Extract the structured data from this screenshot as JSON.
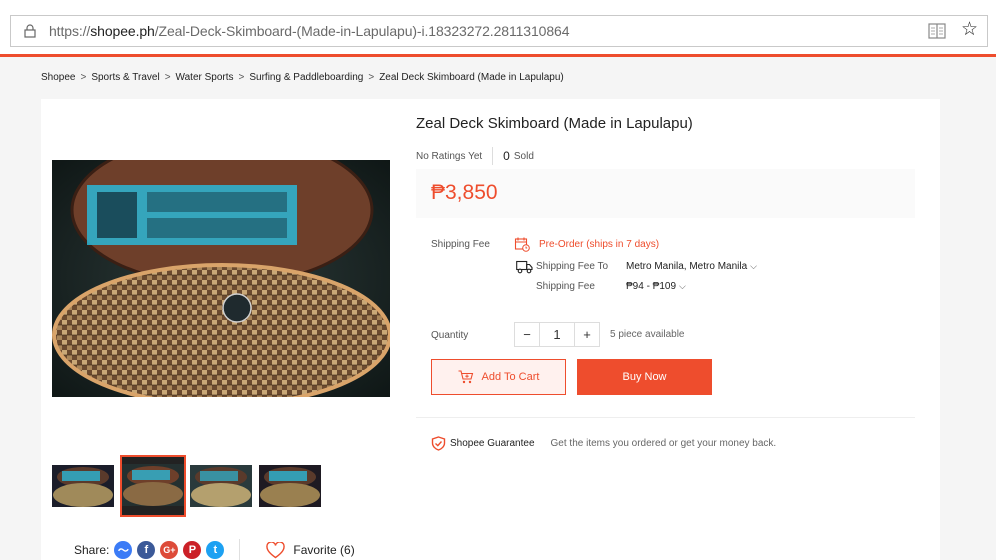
{
  "browser": {
    "url_prefix": "https://",
    "url_host": "shopee.ph",
    "url_path": "/Zeal-Deck-Skimboard-(Made-in-Lapulapu)-i.18323272.2811310864"
  },
  "breadcrumb": [
    "Shopee",
    "Sports & Travel",
    "Water Sports",
    "Surfing & Paddleboarding",
    "Zeal Deck Skimboard (Made in Lapulapu)"
  ],
  "product": {
    "title": "Zeal Deck Skimboard (Made in Lapulapu)",
    "ratings": "No Ratings Yet",
    "sold_count": "0",
    "sold_label": "Sold",
    "price": "₱3,850"
  },
  "shipping": {
    "label": "Shipping Fee",
    "preorder": "Pre-Order (ships in 7 days)",
    "to_label": "Shipping Fee To",
    "to_value": "Metro Manila, Metro Manila",
    "fee_label": "Shipping Fee",
    "fee_value": "₱94 - ₱109"
  },
  "quantity": {
    "label": "Quantity",
    "minus": "−",
    "value": "1",
    "plus": "+",
    "available": "5 piece available"
  },
  "actions": {
    "add_to_cart": "Add To Cart",
    "buy_now": "Buy Now"
  },
  "guarantee": {
    "title": "Shopee Guarantee",
    "text": "Get the items you ordered or get your money back."
  },
  "share": {
    "label": "Share:",
    "favorite": "Favorite (6)"
  },
  "colors": {
    "accent": "#ee4d2d"
  }
}
